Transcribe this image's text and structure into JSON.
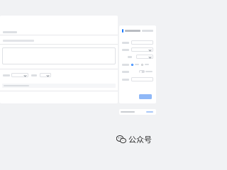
{
  "colors": {
    "page_background": "#f1f2f4",
    "card": "#ffffff",
    "accent": "#1677ff",
    "primary_button_disabled": "#8fb8f7",
    "muted_text": "#b0b4ba"
  },
  "icons": {
    "select_arrow": "chevron-down-icon",
    "watermark": "wechat-icon"
  },
  "watermark": {
    "text": "公众号"
  }
}
